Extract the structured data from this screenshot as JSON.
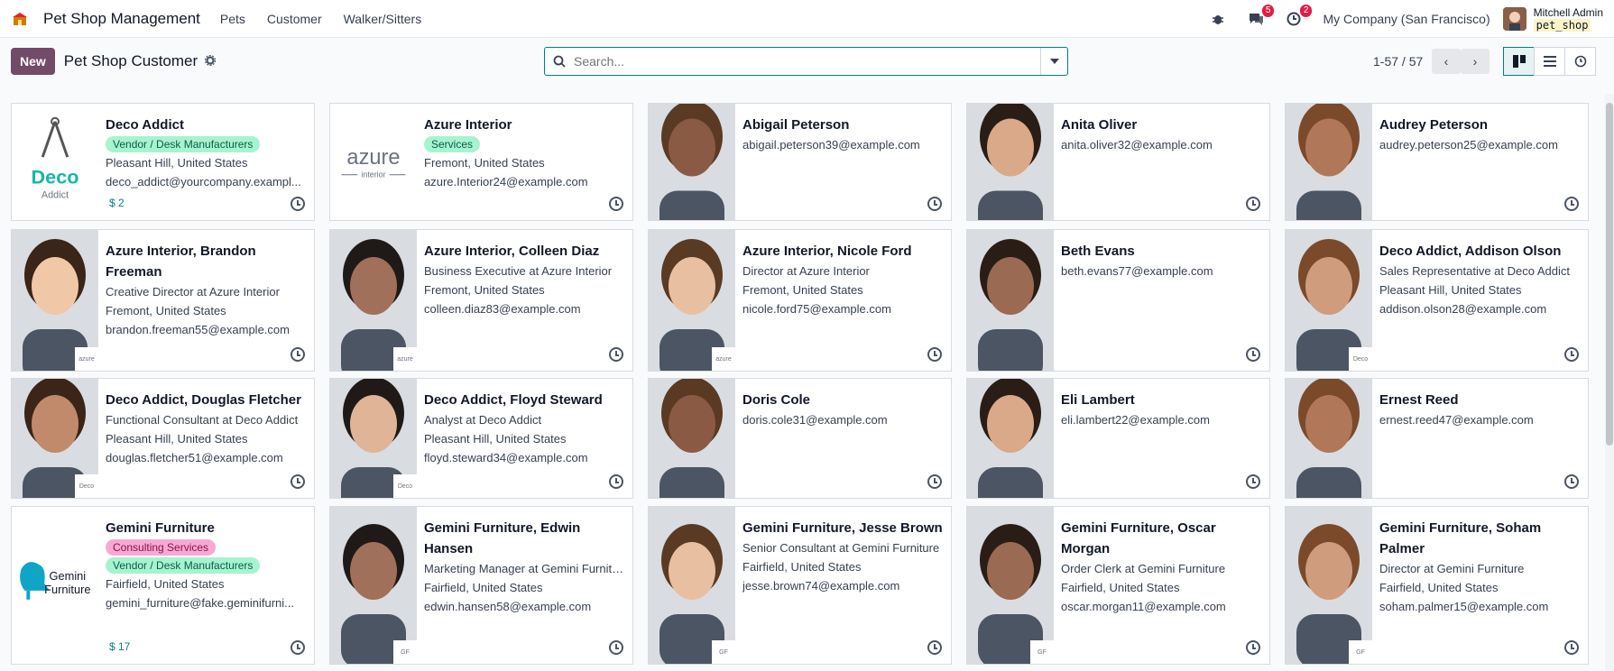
{
  "navbar": {
    "app_name": "Pet Shop Management",
    "menu": [
      "Pets",
      "Customer",
      "Walker/Sitters"
    ],
    "messages_count": "5",
    "activities_count": "2",
    "company": "My Company (San Francisco)",
    "user_name": "Mitchell Admin",
    "database": "pet_shop"
  },
  "control": {
    "new_label": "New",
    "title": "Pet Shop Customer",
    "search_placeholder": "Search...",
    "pager": "1-57 / 57"
  },
  "colors": {
    "brand": "#714b67",
    "accent": "#017e84",
    "tag_green": "#a7f3d0",
    "tag_pink": "#f9a8d4"
  },
  "cards": [
    {
      "name": "Deco Addict",
      "tags": [
        {
          "text": "Vendor / Desk Manufacturers",
          "color": "green"
        }
      ],
      "lines": [
        "Pleasant Hill, United States",
        "deco_addict@yourcompany.exampl..."
      ],
      "amount": "$ 2",
      "img": "deco-logo"
    },
    {
      "name": "Azure Interior",
      "tags": [
        {
          "text": "Services",
          "color": "green"
        }
      ],
      "lines": [
        "Fremont, United States",
        "azure.Interior24@example.com"
      ],
      "img": "azure-logo"
    },
    {
      "name": "Abigail Peterson",
      "lines": [
        "abigail.peterson39@example.com"
      ],
      "img": "photo"
    },
    {
      "name": "Anita Oliver",
      "lines": [
        "anita.oliver32@example.com"
      ],
      "img": "photo"
    },
    {
      "name": "Audrey Peterson",
      "lines": [
        "audrey.peterson25@example.com"
      ],
      "img": "photo"
    },
    {
      "name": "Azure Interior, Brandon Freeman",
      "lines": [
        "Creative Director at Azure Interior",
        "Fremont, United States",
        "brandon.freeman55@example.com"
      ],
      "img": "photo",
      "mini": "azure"
    },
    {
      "name": "Azure Interior, Colleen Diaz",
      "lines": [
        "Business Executive at Azure Interior",
        "Fremont, United States",
        "colleen.diaz83@example.com"
      ],
      "img": "photo",
      "mini": "azure"
    },
    {
      "name": "Azure Interior, Nicole Ford",
      "lines": [
        "Director at Azure Interior",
        "Fremont, United States",
        "nicole.ford75@example.com"
      ],
      "img": "photo",
      "mini": "azure"
    },
    {
      "name": "Beth Evans",
      "lines": [
        "beth.evans77@example.com"
      ],
      "img": "photo"
    },
    {
      "name": "Deco Addict, Addison Olson",
      "lines": [
        "Sales Representative at Deco Addict",
        "Pleasant Hill, United States",
        "addison.olson28@example.com"
      ],
      "img": "photo",
      "mini": "deco"
    },
    {
      "name": "Deco Addict, Douglas Fletcher",
      "lines": [
        "Functional Consultant at Deco Addict",
        "Pleasant Hill, United States",
        "douglas.fletcher51@example.com"
      ],
      "img": "photo",
      "mini": "deco"
    },
    {
      "name": "Deco Addict, Floyd Steward",
      "lines": [
        "Analyst at Deco Addict",
        "Pleasant Hill, United States",
        "floyd.steward34@example.com"
      ],
      "img": "photo",
      "mini": "deco"
    },
    {
      "name": "Doris Cole",
      "lines": [
        "doris.cole31@example.com"
      ],
      "img": "photo"
    },
    {
      "name": "Eli Lambert",
      "lines": [
        "eli.lambert22@example.com"
      ],
      "img": "photo"
    },
    {
      "name": "Ernest Reed",
      "lines": [
        "ernest.reed47@example.com"
      ],
      "img": "photo"
    },
    {
      "name": "Gemini Furniture",
      "tags": [
        {
          "text": "Consulting Services",
          "color": "pink"
        },
        {
          "text": "Vendor / Desk Manufacturers",
          "color": "green"
        }
      ],
      "lines": [
        "Fairfield, United States",
        "gemini_furniture@fake.geminifurni..."
      ],
      "amount": "$ 17",
      "img": "gemini-logo"
    },
    {
      "name": "Gemini Furniture, Edwin Hansen",
      "lines": [
        "Marketing Manager at Gemini Furniture",
        "Fairfield, United States",
        "edwin.hansen58@example.com"
      ],
      "img": "photo",
      "mini": "gemini"
    },
    {
      "name": "Gemini Furniture, Jesse Brown",
      "lines": [
        "Senior Consultant at Gemini Furniture",
        "Fairfield, United States",
        "jesse.brown74@example.com"
      ],
      "img": "photo",
      "mini": "gemini"
    },
    {
      "name": "Gemini Furniture, Oscar Morgan",
      "lines": [
        "Order Clerk at Gemini Furniture",
        "Fairfield, United States",
        "oscar.morgan11@example.com"
      ],
      "img": "photo",
      "mini": "gemini"
    },
    {
      "name": "Gemini Furniture, Soham Palmer",
      "lines": [
        "Director at Gemini Furniture",
        "Fairfield, United States",
        "soham.palmer15@example.com"
      ],
      "img": "photo",
      "mini": "gemini"
    }
  ]
}
